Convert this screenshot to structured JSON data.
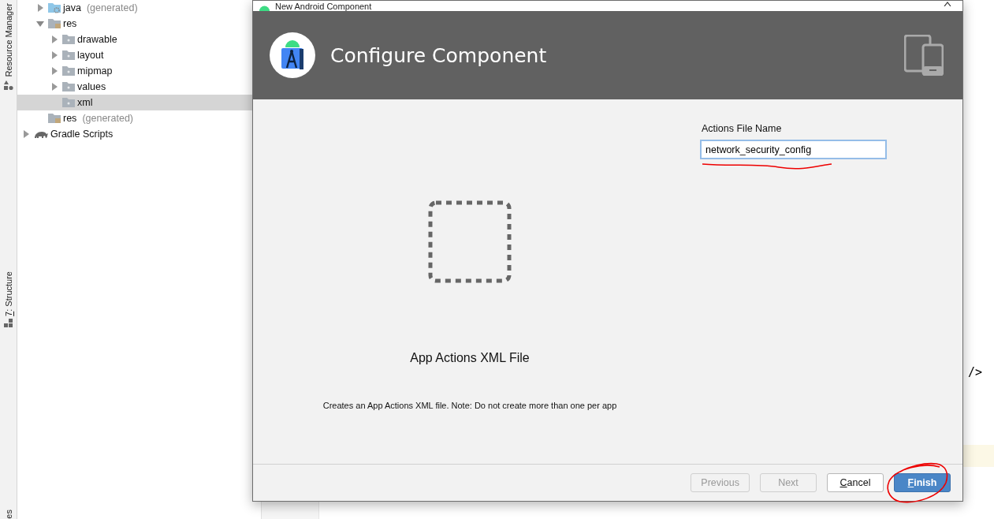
{
  "tool_strip": [
    {
      "label": "Resource Manager",
      "underline_first": false
    },
    {
      "label": "7: Structure",
      "underline_first": true
    },
    {
      "label": "es",
      "underline_first": false
    }
  ],
  "project_tree": [
    {
      "children": [
        {
          "label": "java",
          "suffix": "(generated)",
          "kind": "java",
          "expanded": false,
          "selected": false
        },
        {
          "label": "res",
          "kind": "res",
          "expanded": true,
          "selected": false,
          "children": [
            {
              "label": "drawable",
              "kind": "folder",
              "expanded": false,
              "selected": false
            },
            {
              "label": "layout",
              "kind": "folder",
              "expanded": false,
              "selected": false
            },
            {
              "label": "mipmap",
              "kind": "folder",
              "expanded": false,
              "selected": false
            },
            {
              "label": "values",
              "kind": "folder",
              "expanded": false,
              "selected": false
            },
            {
              "label": "xml",
              "kind": "folder",
              "leaf": true,
              "selected": true
            }
          ]
        },
        {
          "label": "res",
          "suffix": "(generated)",
          "kind": "res",
          "leaf": true,
          "selected": false
        }
      ]
    },
    {
      "label": "Gradle Scripts",
      "kind": "gradle",
      "expanded": false,
      "selected": false
    }
  ],
  "editor": {
    "code_line": "/>"
  },
  "dialog": {
    "title": "New Android Component",
    "heading": "Configure Component",
    "field": {
      "label": "Actions File Name",
      "value": "network_security_config",
      "focused": true
    },
    "template_name": "App Actions XML File",
    "description": "Creates an App Actions XML file. Note: Do not create more than one per app",
    "buttons": [
      {
        "label": "Previous",
        "disabled": true,
        "primary": false,
        "underline_first": false
      },
      {
        "label": "Next",
        "disabled": true,
        "primary": false,
        "underline_first": false
      },
      {
        "label": "Cancel",
        "disabled": false,
        "primary": false,
        "underline_first": true
      },
      {
        "label": "Finish",
        "disabled": false,
        "primary": true,
        "underline_first": true
      }
    ]
  }
}
